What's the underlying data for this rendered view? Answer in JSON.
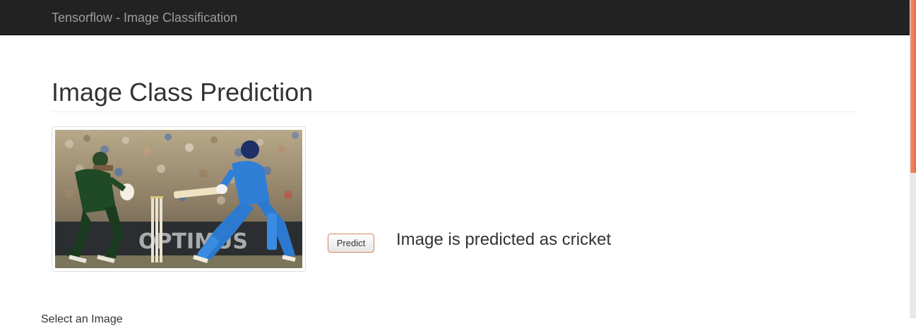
{
  "navbar": {
    "brand": "Tensorflow - Image Classification"
  },
  "page": {
    "title": "Image Class Prediction"
  },
  "image": {
    "alt": "cricket"
  },
  "actions": {
    "predict_label": "Predict"
  },
  "result": {
    "text": "Image is predicted as cricket"
  },
  "footer": {
    "select_label": "Select an Image"
  },
  "colors": {
    "navbar_bg": "#222222",
    "brand_text": "#9d9d9d",
    "button_border": "#d9825f",
    "scroll_thumb": "#ee6b43"
  }
}
